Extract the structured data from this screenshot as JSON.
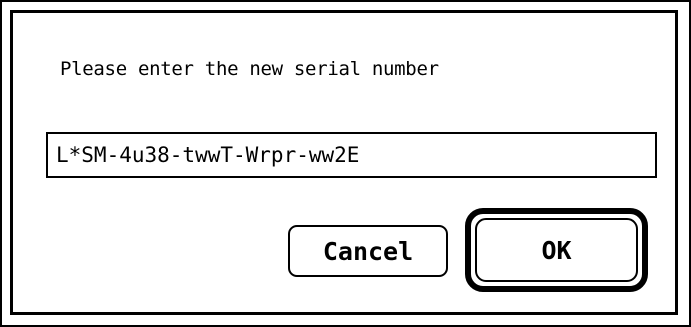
{
  "dialog": {
    "prompt": "Please enter the new serial number",
    "serial_field": {
      "value": "L*SM-4u38-twwT-Wrpr-ww2E"
    },
    "buttons": {
      "cancel_label": "Cancel",
      "ok_label": "OK"
    }
  }
}
